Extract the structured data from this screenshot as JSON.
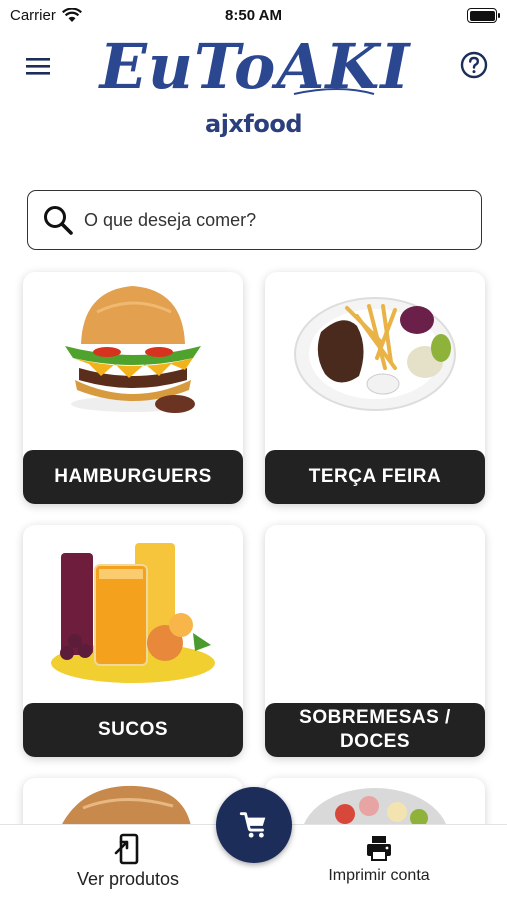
{
  "status_bar": {
    "carrier": "Carrier",
    "time": "8:50 AM",
    "battery_level": 1.0
  },
  "header": {
    "logo_text": "EuToAKI",
    "logo_sub": "ajxfood",
    "menu_icon": "hamburger-menu-icon",
    "help_icon": "question-circle-icon"
  },
  "search": {
    "placeholder": "O que deseja comer?",
    "icon": "search-icon"
  },
  "categories": [
    {
      "label": "HAMBURGUERS"
    },
    {
      "label": "TERÇA FEIRA"
    },
    {
      "label": "SUCOS"
    },
    {
      "label": "SOBREMESAS / DOCES"
    }
  ],
  "bottom_nav": {
    "products_label": "Ver produtos",
    "print_label": "Imprimir conta",
    "cart_icon": "shopping-cart-icon"
  },
  "colors": {
    "brand_navy": "#1c2d5a",
    "label_bg": "#222222",
    "logo_blue": "#2a3f7c"
  }
}
